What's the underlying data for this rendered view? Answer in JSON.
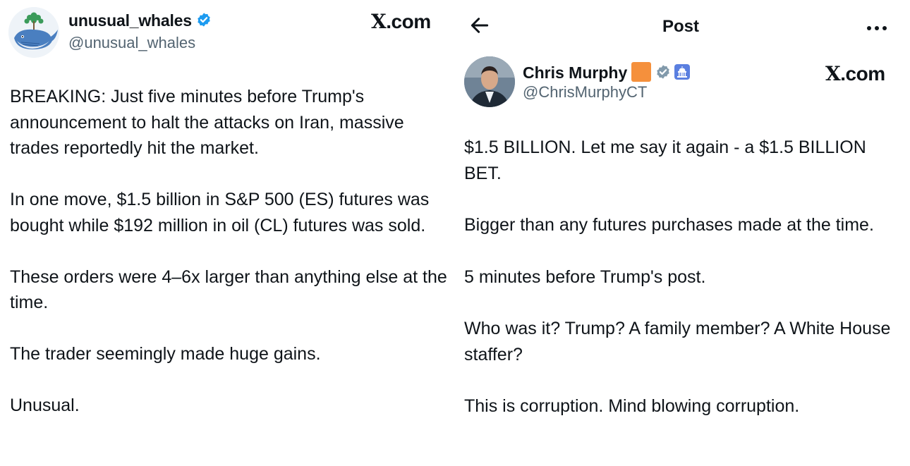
{
  "left_post": {
    "display_name": "unusual_whales",
    "handle": "@unusual_whales",
    "brand": "X",
    "brand_suffix": ".com",
    "paragraphs": [
      "BREAKING: Just five minutes before Trump's announcement to halt the attacks on Iran, massive trades reportedly hit the market.",
      "In one move, $1.5 billion in S&P 500 (ES) futures was bought while $192 million in oil (CL) futures was sold.",
      "These orders were 4–6x larger than anything else at the time.",
      "The trader seemingly made huge gains.",
      "Unusual."
    ]
  },
  "right_post": {
    "header_title": "Post",
    "display_name": "Chris Murphy",
    "handle": "@ChrisMurphyCT",
    "brand": "X",
    "brand_suffix": ".com",
    "paragraphs": [
      "$1.5 BILLION. Let me say it again - a $1.5 BILLION BET.",
      "Bigger than any futures purchases made at the time.",
      "5 minutes before Trump's post.",
      "Who was it? Trump? A family member? A White House staffer?",
      "This is corruption. Mind blowing corruption."
    ]
  },
  "colors": {
    "text": "#0f1419",
    "secondary": "#536471",
    "verified_blue": "#1d9bf0",
    "gov_gray": "#829aab",
    "orange": "#f5903c"
  },
  "icons": {
    "back": "arrow-left-icon",
    "more": "more-horizontal-icon",
    "verified": "verified-badge-icon",
    "gov": "government-badge-icon",
    "capitol": "capitol-icon"
  }
}
